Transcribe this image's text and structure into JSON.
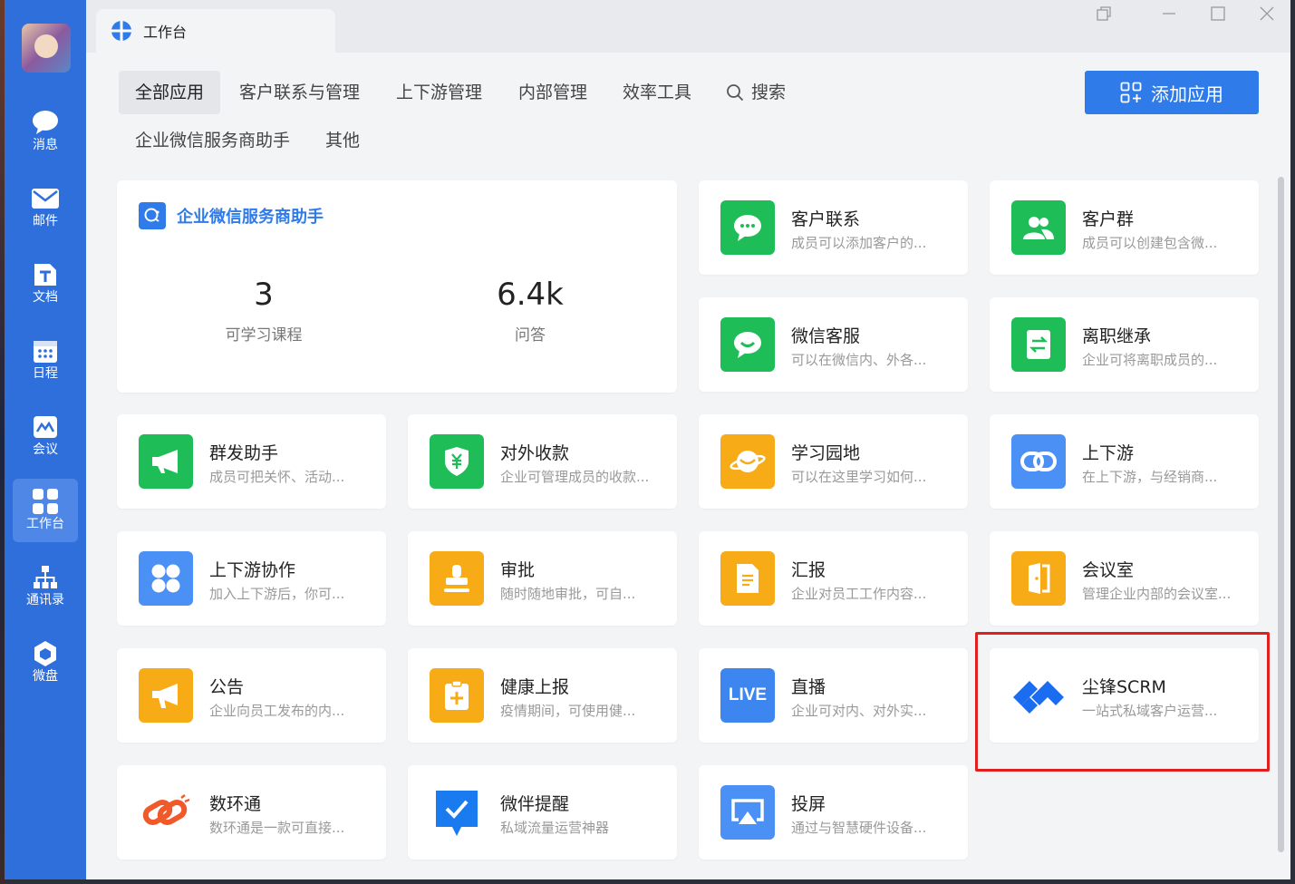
{
  "sidebar": {
    "items": [
      {
        "label": "消息",
        "icon": "chat-bubble-icon"
      },
      {
        "label": "邮件",
        "icon": "mail-icon"
      },
      {
        "label": "文档",
        "icon": "document-icon"
      },
      {
        "label": "日程",
        "icon": "calendar-icon"
      },
      {
        "label": "会议",
        "icon": "meeting-icon"
      },
      {
        "label": "工作台",
        "icon": "workbench-grid-icon",
        "active": true
      },
      {
        "label": "通讯录",
        "icon": "org-chart-icon"
      },
      {
        "label": "微盘",
        "icon": "cloud-drive-icon"
      }
    ]
  },
  "window": {
    "tab_title": "工作台"
  },
  "categories": [
    "全部应用",
    "客户联系与管理",
    "上下游管理",
    "内部管理",
    "效率工具",
    "搜索",
    "企业微信服务商助手",
    "其他"
  ],
  "add_app_label": "添加应用",
  "featured": {
    "title": "企业微信服务商助手",
    "stats": [
      {
        "value": "3",
        "label": "可学习课程"
      },
      {
        "value": "6.4k",
        "label": "问答"
      }
    ]
  },
  "apps": [
    {
      "name": "客户联系",
      "desc": "成员可以添加客户的...",
      "icon": "chat-smile-icon",
      "color": "#1ebd57"
    },
    {
      "name": "客户群",
      "desc": "成员可以创建包含微...",
      "icon": "group-people-icon",
      "color": "#1ebd57"
    },
    {
      "name": "微信客服",
      "desc": "可以在微信内、外各...",
      "icon": "service-chat-icon",
      "color": "#1ebd57"
    },
    {
      "name": "离职继承",
      "desc": "企业可将离职成员的...",
      "icon": "transfer-doc-icon",
      "color": "#1ebd57"
    },
    {
      "name": "群发助手",
      "desc": "成员可把关怀、活动...",
      "icon": "megaphone-icon",
      "color": "#1ebd57"
    },
    {
      "name": "对外收款",
      "desc": "企业可管理成员的收款...",
      "icon": "yuan-shield-icon",
      "color": "#1ebd57"
    },
    {
      "name": "学习园地",
      "desc": "可以在这里学习如何...",
      "icon": "planet-icon",
      "color": "#f7ab16"
    },
    {
      "name": "上下游",
      "desc": "在上下游，与经销商...",
      "icon": "link-chain-icon",
      "color": "#4a90f5"
    },
    {
      "name": "上下游协作",
      "desc": "加入上下游后，你可...",
      "icon": "four-dots-icon",
      "color": "#4a90f5"
    },
    {
      "name": "审批",
      "desc": "随时随地审批，可自...",
      "icon": "stamp-icon",
      "color": "#f7ab16"
    },
    {
      "name": "汇报",
      "desc": "企业对员工工作内容...",
      "icon": "report-doc-icon",
      "color": "#f7ab16"
    },
    {
      "name": "会议室",
      "desc": "管理企业内部的会议室...",
      "icon": "door-icon",
      "color": "#f7ab16"
    },
    {
      "name": "公告",
      "desc": "企业向员工发布的内...",
      "icon": "announcement-horn-icon",
      "color": "#f7ab16"
    },
    {
      "name": "健康上报",
      "desc": "疫情期间，可使用健...",
      "icon": "clipboard-plus-icon",
      "color": "#f7ab16"
    },
    {
      "name": "直播",
      "desc": "企业可对内、对外实...",
      "icon": "live-icon",
      "color": "#3d86f0",
      "icon_text": "LIVE"
    },
    {
      "name": "尘锋SCRM",
      "desc": "一站式私域客户运营...",
      "icon": "chenfeng-logo-icon",
      "color": "#1a6cf0"
    },
    {
      "name": "数环通",
      "desc": "数环通是一款可直接...",
      "icon": "shuhuantong-logo-icon",
      "color": "#f05a2a"
    },
    {
      "name": "微伴提醒",
      "desc": "私域流量运营神器",
      "icon": "check-bubble-icon",
      "color": "#1a7af0"
    },
    {
      "name": "投屏",
      "desc": "通过与智慧硬件设备...",
      "icon": "screen-cast-icon",
      "color": "#4a90f5"
    }
  ]
}
